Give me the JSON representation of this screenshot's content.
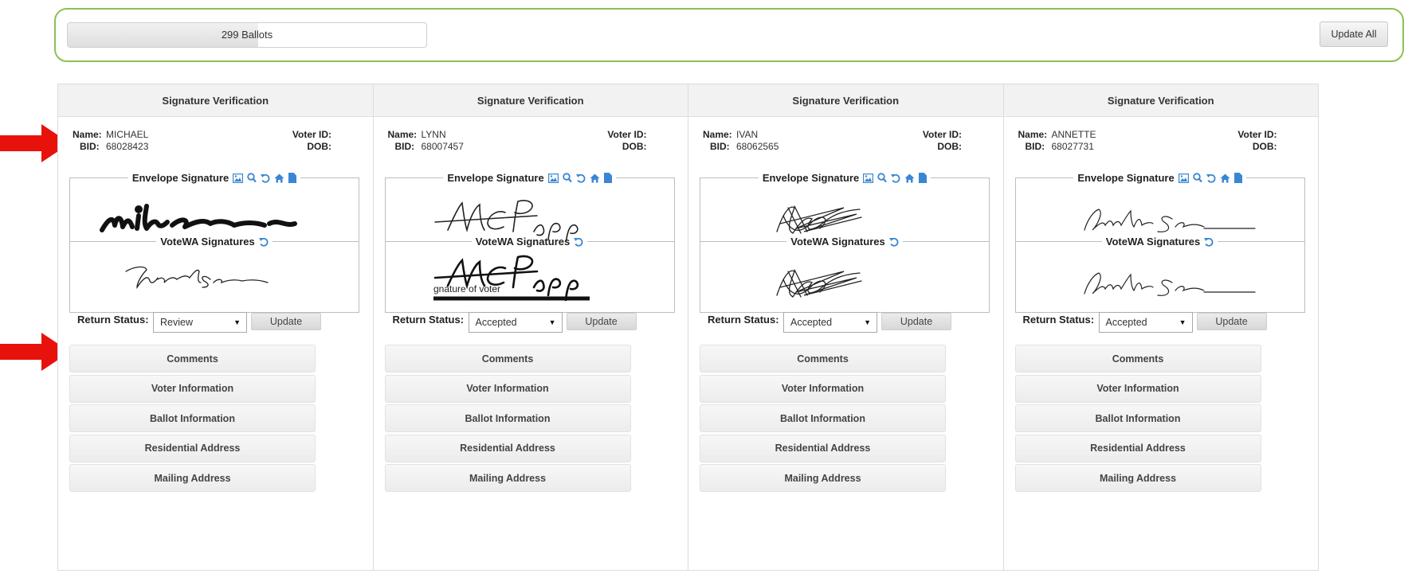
{
  "topbar": {
    "progress_label": "299 Ballots",
    "progress_fraction": 0.53,
    "update_all_label": "Update All"
  },
  "labels": {
    "header": "Signature Verification",
    "name": "Name:",
    "bid": "BID:",
    "voter_id": "Voter ID:",
    "dob": "DOB:",
    "envelope_signature": "Envelope Signature",
    "votewa_signatures": "VoteWA Signatures",
    "return_status": "Return Status:",
    "update": "Update",
    "sections": [
      "Comments",
      "Voter Information",
      "Ballot Information",
      "Residential Address",
      "Mailing Address"
    ]
  },
  "cards": [
    {
      "name": "MICHAEL",
      "bid": "68028423",
      "status": "Review"
    },
    {
      "name": "LYNN",
      "bid": "68007457",
      "status": "Accepted"
    },
    {
      "name": "IVAN",
      "bid": "68062565",
      "status": "Accepted"
    },
    {
      "name": "ANNETTE",
      "bid": "68027731",
      "status": "Accepted"
    }
  ],
  "vwa_overlay_text": "gnature of voter",
  "colors": {
    "accent_border": "#8cc152",
    "arrow": "#e8120c",
    "tool_icon": "#3a86d4"
  },
  "icons": {
    "arrow": "arrow-right-icon",
    "tools": [
      "image-icon",
      "search-icon",
      "rotate-icon",
      "home-icon",
      "file-icon"
    ],
    "vwa_tool": "rotate-icon",
    "caret": "caret-down-icon"
  }
}
